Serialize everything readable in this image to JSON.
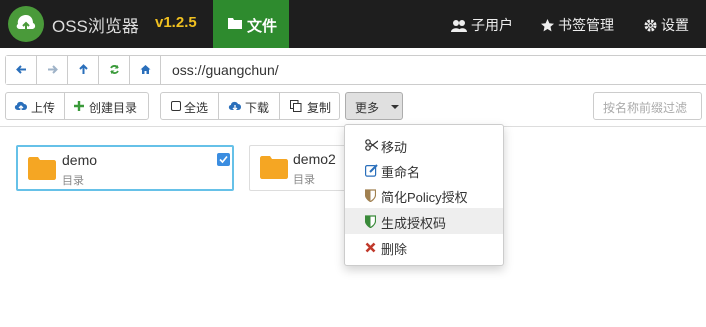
{
  "app": {
    "brand": "OSS浏览器",
    "version": "v1.2.5"
  },
  "nav": {
    "file": "文件",
    "subusers": "子用户",
    "bookmarks": "书签管理",
    "settings": "设置"
  },
  "address": {
    "path": "oss://guangchun/"
  },
  "toolbar": {
    "upload": "上传",
    "create_dir": "创建目录",
    "select_all": "全选",
    "download": "下载",
    "copy": "复制",
    "more": "更多",
    "filter_placeholder": "按名称前缀过滤"
  },
  "files": [
    {
      "name": "demo",
      "type": "目录",
      "selected": true
    },
    {
      "name": "demo2",
      "type": "目录",
      "selected": false
    }
  ],
  "menu": {
    "items": [
      {
        "label": "移动",
        "icon": "scissors-icon"
      },
      {
        "label": "重命名",
        "icon": "edit-icon"
      },
      {
        "label": "简化Policy授权",
        "icon": "shield-icon"
      },
      {
        "label": "生成授权码",
        "icon": "shield-icon"
      },
      {
        "label": "删除",
        "icon": "x-icon"
      }
    ],
    "highlighted": "生成授权码"
  },
  "colors": {
    "accent_green": "#2e8b2e",
    "version_yellow": "#f0c020",
    "select_blue": "#66c1e8",
    "folder": "#f5a623"
  }
}
